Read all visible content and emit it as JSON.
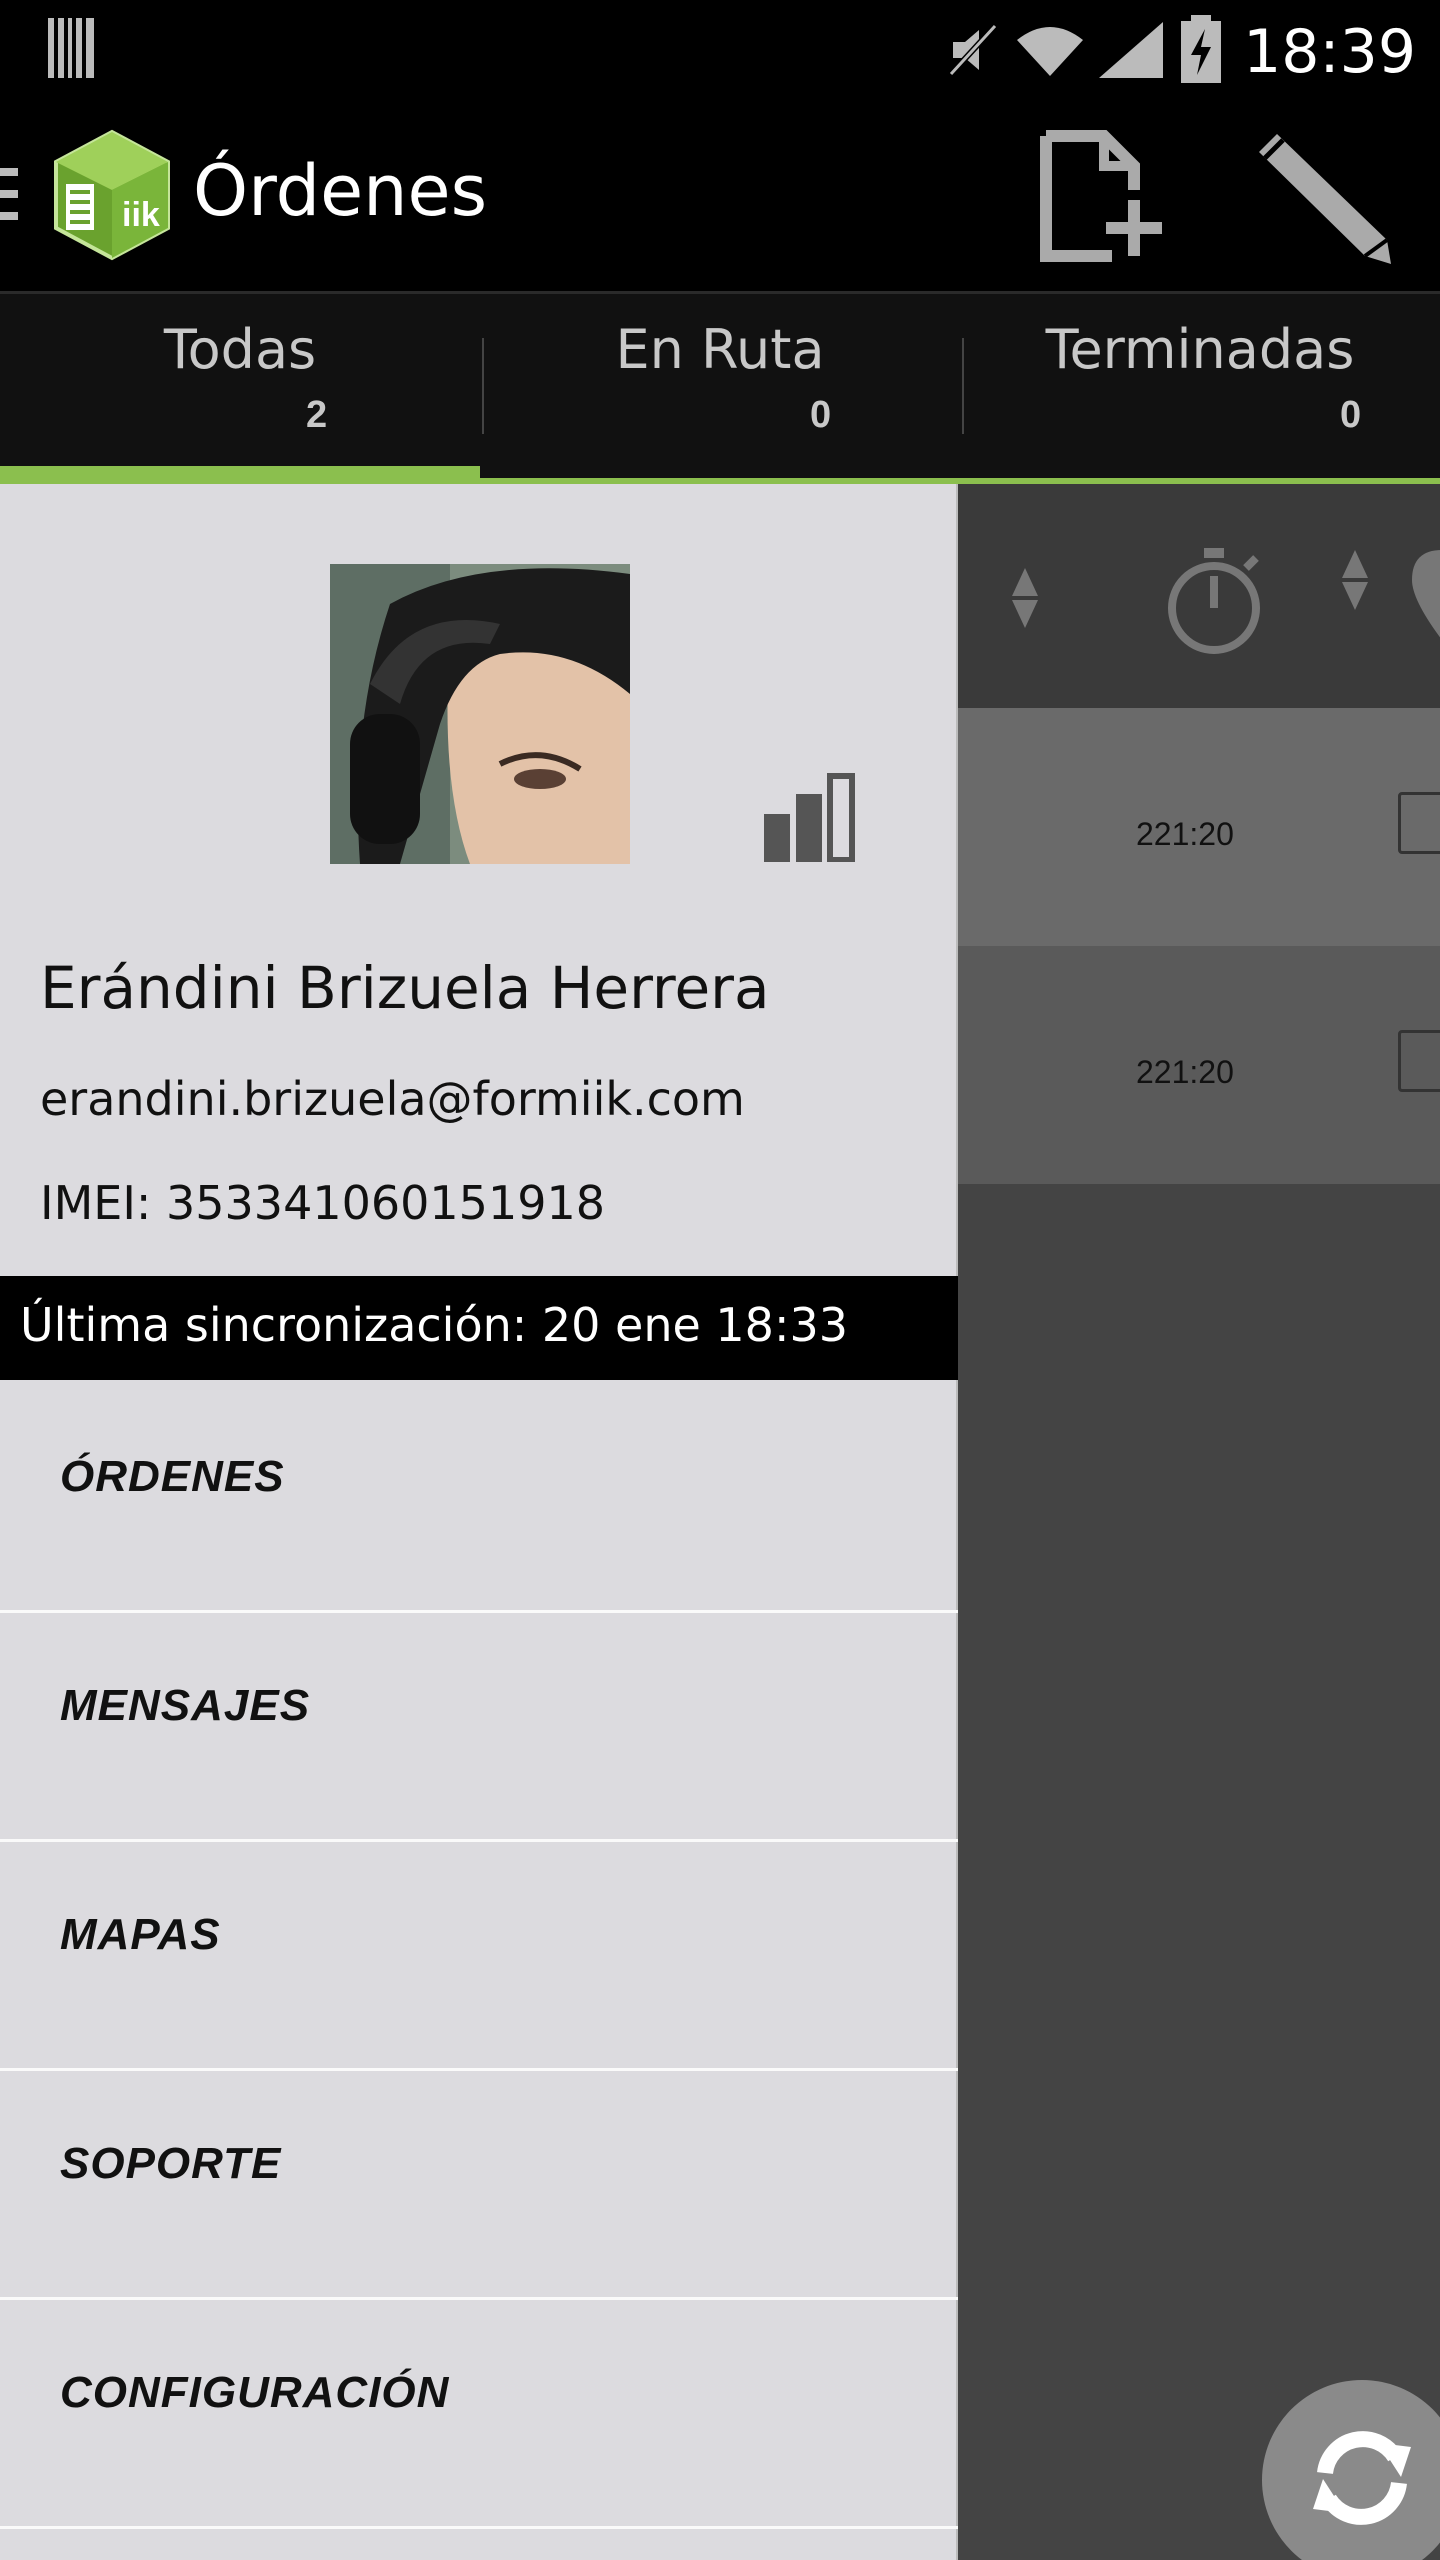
{
  "status_bar": {
    "time": "18:39"
  },
  "action_bar": {
    "title": "Órdenes"
  },
  "tabs": [
    {
      "label": "Todas",
      "count": "2"
    },
    {
      "label": "En Ruta",
      "count": "0"
    },
    {
      "label": "Terminadas",
      "count": "0"
    }
  ],
  "profile": {
    "name": "Erándini Brizuela Herrera",
    "email": "erandini.brizuela@formiik.com",
    "imei": "IMEI: 353341060151918"
  },
  "sync": {
    "label": "Última sincronización: 20 ene 18:33"
  },
  "menu": [
    {
      "label": "ÓRDENES"
    },
    {
      "label": "MENSAJES"
    },
    {
      "label": "MAPAS"
    },
    {
      "label": "SOPORTE"
    },
    {
      "label": "CONFIGURACIÓN"
    }
  ],
  "orders": [
    {
      "time": "221:20"
    },
    {
      "time": "221:20"
    }
  ],
  "colors": {
    "accent": "#8bbf4e",
    "drawer_bg": "#dcdbdf",
    "bar_bg": "#000000"
  },
  "icons": [
    "barcode-icon",
    "mute-icon",
    "wifi-icon",
    "signal-icon",
    "battery-icon",
    "hamburger-icon",
    "app-logo-icon",
    "new-document-icon",
    "edit-pencil-icon",
    "sort-icon",
    "stopwatch-icon",
    "location-pin-icon",
    "refresh-icon"
  ]
}
